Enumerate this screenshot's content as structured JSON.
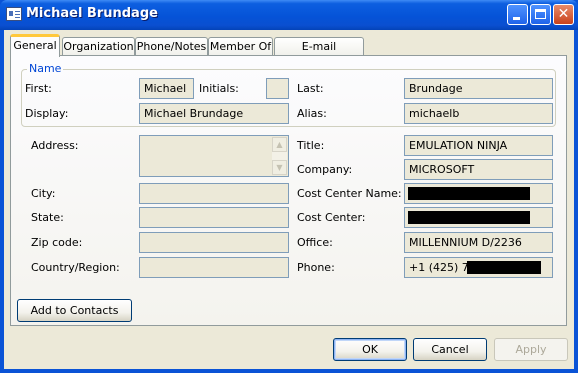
{
  "window": {
    "title": "Michael Brundage"
  },
  "tabs": [
    "General",
    "Organization",
    "Phone/Notes",
    "Member Of",
    "E-mail Addresses"
  ],
  "name_group": {
    "legend": "Name",
    "first_label": "First:",
    "first_value": "Michael",
    "initials_label": "Initials:",
    "initials_value": "",
    "last_label": "Last:",
    "last_value": "Brundage",
    "display_label": "Display:",
    "display_value": "Michael Brundage",
    "alias_label": "Alias:",
    "alias_value": "michaelb"
  },
  "address": {
    "address_label": "Address:",
    "address_value": "",
    "city_label": "City:",
    "city_value": "",
    "state_label": "State:",
    "state_value": "",
    "zip_label": "Zip code:",
    "zip_value": "",
    "country_label": "Country/Region:",
    "country_value": ""
  },
  "org": {
    "title_label": "Title:",
    "title_value": "EMULATION NINJA",
    "company_label": "Company:",
    "company_value": "MICROSOFT",
    "cost_center_name_label": "Cost Center Name:",
    "cost_center_label": "Cost Center:",
    "office_label": "Office:",
    "office_value": "MILLENNIUM D/2236",
    "phone_label": "Phone:",
    "phone_value": "+1 (425) 70"
  },
  "buttons": {
    "add_to_contacts": "Add to Contacts",
    "ok": "OK",
    "cancel": "Cancel",
    "apply": "Apply"
  },
  "colors": {
    "titlebar": "#0553d8",
    "dialog_bg": "#ece9d8",
    "legend": "#0046d5",
    "active_tab_accent": "#ffc83c"
  }
}
